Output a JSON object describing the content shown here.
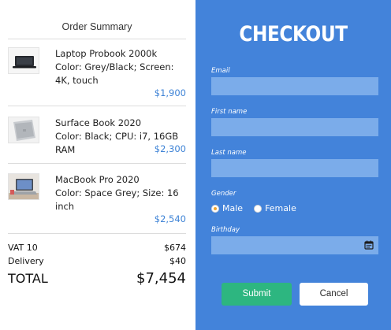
{
  "summary": {
    "title": "Order Summary",
    "items": [
      {
        "name": "Laptop Probook 2000k",
        "details": "Color: Grey/Black; Screen: 4K, touch",
        "price": "$1,900",
        "icon": "laptop-black-image"
      },
      {
        "name": "Surface Book 2020",
        "details": "Color: Black; CPU: i7, 16GB RAM",
        "price": "$2,300",
        "icon": "laptop-silver-image"
      },
      {
        "name": "MacBook Pro 2020",
        "details": "Color: Space Grey; Size: 16 inch",
        "price": "$2,540",
        "icon": "laptop-desk-image"
      }
    ],
    "totals": {
      "vat_label": "VAT 10",
      "vat_value": "$674",
      "delivery_label": "Delivery",
      "delivery_value": "$40",
      "total_label": "TOTAL",
      "total_value": "$7,454"
    }
  },
  "checkout": {
    "title": "CHECKOUT",
    "email_label": "Email",
    "email_value": "",
    "first_name_label": "First name",
    "first_name_value": "",
    "last_name_label": "Last name",
    "last_name_value": "",
    "gender_label": "Gender",
    "gender_options": [
      "Male",
      "Female"
    ],
    "gender_selected": "Male",
    "birthday_label": "Birthday",
    "birthday_value": "",
    "birthday_icon": "calendar-icon",
    "submit_label": "Submit",
    "cancel_label": "Cancel"
  },
  "colors": {
    "accent": "#4383da",
    "field": "#7bacea",
    "price": "#3e83d6",
    "submit": "#2db680",
    "radio_checked": "#f0a630"
  }
}
